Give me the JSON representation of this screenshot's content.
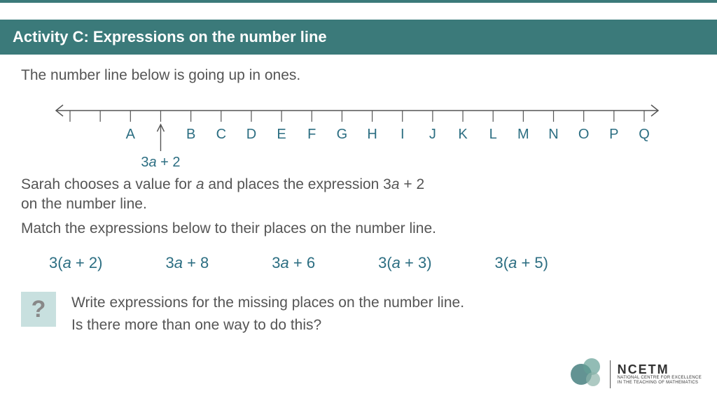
{
  "header": {
    "title": "Activity C: Expressions on the number line"
  },
  "intro": "The number line below is going up in ones.",
  "number_line": {
    "labels": [
      "A",
      "B",
      "C",
      "D",
      "E",
      "F",
      "G",
      "H",
      "I",
      "J",
      "K",
      "L",
      "M",
      "N",
      "O",
      "P",
      "Q"
    ],
    "pointer_label_pre": "3",
    "pointer_label_var": "a",
    "pointer_label_post": " + 2"
  },
  "body": {
    "p1_pre": "Sarah chooses a value for ",
    "p1_var": "a",
    "p1_mid": " and places the expression 3",
    "p1_var2": "a",
    "p1_post": " + 2",
    "p1_line2": "on the number line.",
    "p2": "Match the expressions below to their places on the number line."
  },
  "expressions": [
    {
      "pre": "3(",
      "var": "a",
      "post": " + 2)"
    },
    {
      "pre": "3",
      "var": "a",
      "post": " + 8"
    },
    {
      "pre": "3",
      "var": "a",
      "post": " + 6"
    },
    {
      "pre": "3(",
      "var": "a",
      "post": " + 3)"
    },
    {
      "pre": "3(",
      "var": "a",
      "post": " + 5)"
    }
  ],
  "question": {
    "icon": "?",
    "line1": "Write expressions for the missing places on the number line.",
    "line2": "Is there more than one way to do this?"
  },
  "logo": {
    "acronym": "NCETM",
    "line2": "NATIONAL CENTRE FOR EXCELLENCE",
    "line3": "IN THE TEACHING OF MATHEMATICS"
  },
  "chart_data": {
    "type": "line",
    "title": "Number line going up in ones",
    "tick_count_total": 20,
    "labeled_ticks": [
      {
        "pos": 3,
        "label": "A"
      },
      {
        "pos": 5,
        "label": "B"
      },
      {
        "pos": 6,
        "label": "C"
      },
      {
        "pos": 7,
        "label": "D"
      },
      {
        "pos": 8,
        "label": "E"
      },
      {
        "pos": 9,
        "label": "F"
      },
      {
        "pos": 10,
        "label": "G"
      },
      {
        "pos": 11,
        "label": "H"
      },
      {
        "pos": 12,
        "label": "I"
      },
      {
        "pos": 13,
        "label": "J"
      },
      {
        "pos": 14,
        "label": "K"
      },
      {
        "pos": 15,
        "label": "L"
      },
      {
        "pos": 16,
        "label": "M"
      },
      {
        "pos": 17,
        "label": "N"
      },
      {
        "pos": 18,
        "label": "O"
      },
      {
        "pos": 19,
        "label": "P"
      },
      {
        "pos": 20,
        "label": "Q"
      }
    ],
    "pointer": {
      "pos": 4,
      "expression": "3a + 2"
    }
  }
}
